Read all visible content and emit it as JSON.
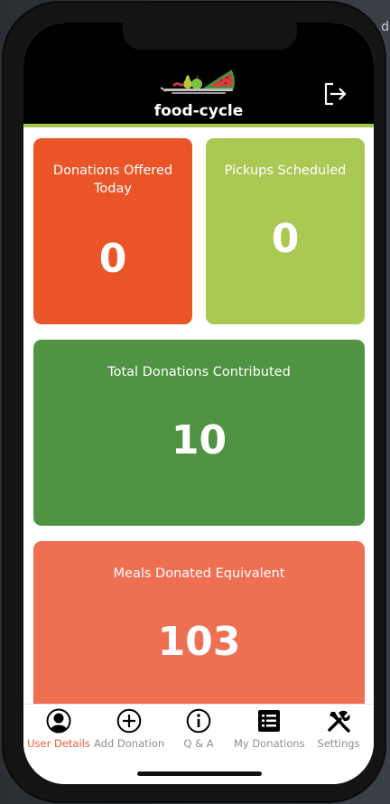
{
  "edge_text": "d",
  "app": {
    "name": "food-cycle",
    "colors": {
      "header_bg": "#000000",
      "accent_green": "#a3c64a",
      "active_tab": "#e85d3b",
      "inactive_tab": "#8e8e93"
    }
  },
  "header": {
    "logo_icon": "food-cycle-logo-icon",
    "logout_icon": "logout-icon"
  },
  "cards": [
    {
      "label": "Donations Offered Today",
      "value": "0",
      "color": "#ea5527"
    },
    {
      "label": "Pickups Scheduled",
      "value": "0",
      "color": "#a9c954"
    },
    {
      "label": "Total Donations Contributed",
      "value": "10",
      "color": "#509443"
    },
    {
      "label": "Meals Donated Equivalent",
      "value": "103",
      "color": "#ef6f53"
    }
  ],
  "tabs": [
    {
      "label": "User Details",
      "icon": "user-icon",
      "active": true
    },
    {
      "label": "Add Donation",
      "icon": "plus-circle-icon",
      "active": false
    },
    {
      "label": "Q & A",
      "icon": "info-icon",
      "active": false
    },
    {
      "label": "My Donations",
      "icon": "list-icon",
      "active": false
    },
    {
      "label": "Settings",
      "icon": "tools-icon",
      "active": false
    }
  ]
}
